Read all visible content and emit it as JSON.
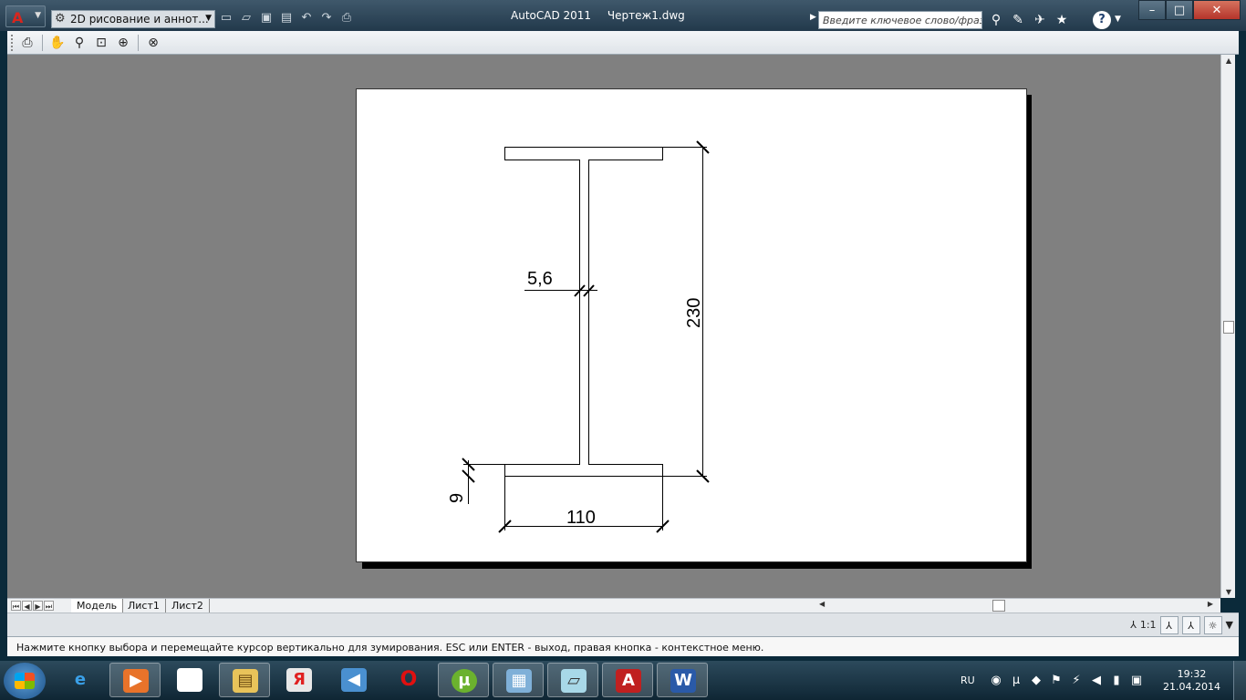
{
  "titlebar": {
    "workspace": "2D рисование и аннот...",
    "app_name": "AutoCAD 2011",
    "document": "Чертеж1.dwg",
    "search_placeholder": "Введите ключевое слово/фразу"
  },
  "icons": {
    "app_menu": "autocad-logo-icon",
    "gear": "gear-icon",
    "qat": [
      "new-icon",
      "open-icon",
      "save-icon",
      "saveas-icon",
      "undo-icon",
      "redo-icon",
      "plot-icon"
    ],
    "toolbar": [
      "print-icon",
      "pan-icon",
      "zoom-icon",
      "zoom-window-icon",
      "zoom-previous-icon",
      "close-icon"
    ],
    "search": [
      "binoculars-icon",
      "communication-center-icon",
      "satellite-icon",
      "favorites-icon"
    ]
  },
  "drawing": {
    "dim_web": "5,6",
    "dim_height": "230",
    "dim_flange": "9",
    "dim_width": "110"
  },
  "tabs": {
    "model": "Модель",
    "layout1": "Лист1",
    "layout2": "Лист2"
  },
  "status": {
    "scale": "1:1"
  },
  "command_prompt": "Нажмите кнопку выбора и перемещайте курсор вертикально для зумирования. ESC или ENTER - выход, правая кнопка - контекстное меню.",
  "taskbar": {
    "lang": "RU",
    "time": "19:32",
    "date": "21.04.2014",
    "apps": [
      "internet-explorer-icon",
      "media-player-icon",
      "document-icon",
      "explorer-icon",
      "yandex-icon",
      "audio-icon",
      "opera-icon",
      "utorrent-icon",
      "control-panel-icon",
      "notepad-icon",
      "autocad-icon",
      "word-icon"
    ]
  },
  "colors": {
    "canvas_bg": "#808080",
    "paper": "#ffffff",
    "titlebar": "#2e4659"
  }
}
